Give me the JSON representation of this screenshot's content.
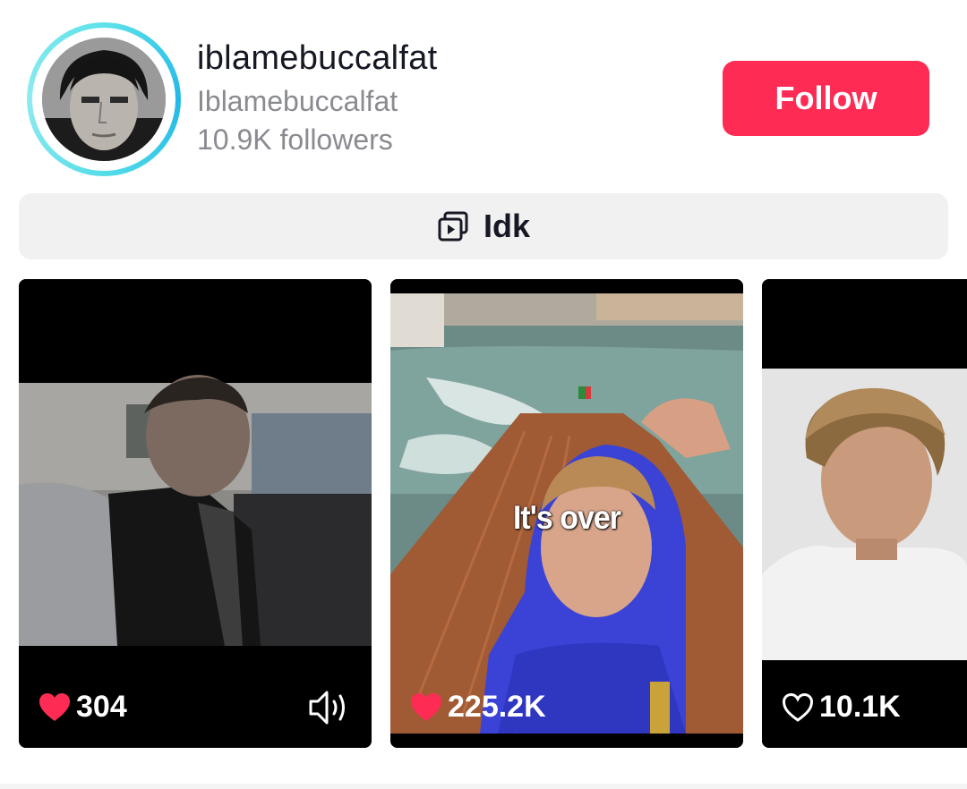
{
  "profile": {
    "username": "iblamebuccalfat",
    "nickname": "Iblamebuccalfat",
    "followers": "10.9K followers",
    "follow_label": "Follow",
    "avatar_icon": "user-photo"
  },
  "playlist": {
    "label": "Idk",
    "icon": "playlist-icon"
  },
  "videos": [
    {
      "likes": "304",
      "liked": true,
      "icon": "volume-icon"
    },
    {
      "likes": "225.2K",
      "liked": true,
      "overlay_text": "It's over"
    },
    {
      "likes": "10.1K",
      "liked": false
    }
  ],
  "colors": {
    "accent": "#fe2c55",
    "ring": "#22b8e6",
    "text": "#161823",
    "muted": "#8a8b91"
  }
}
